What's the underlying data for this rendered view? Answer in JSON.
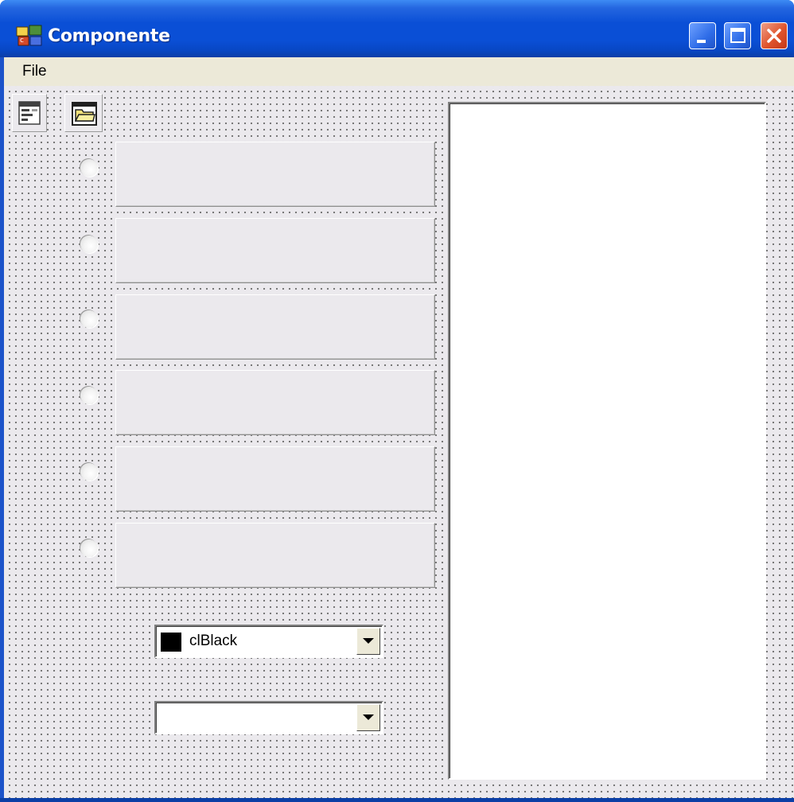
{
  "window": {
    "title": "Componente"
  },
  "menu": {
    "items": [
      {
        "label": "File"
      }
    ]
  },
  "toolbar": {
    "icons": [
      "properties-icon",
      "open-folder-icon"
    ]
  },
  "radio_options": [
    {},
    {},
    {},
    {},
    {},
    {}
  ],
  "color_combo": {
    "value": "clBlack",
    "swatch_color": "#000000"
  },
  "second_combo": {
    "value": ""
  },
  "colors": {
    "titlebar": "#0a4fd6",
    "close": "#e0542c",
    "form_bg": "#ebe9ed"
  }
}
